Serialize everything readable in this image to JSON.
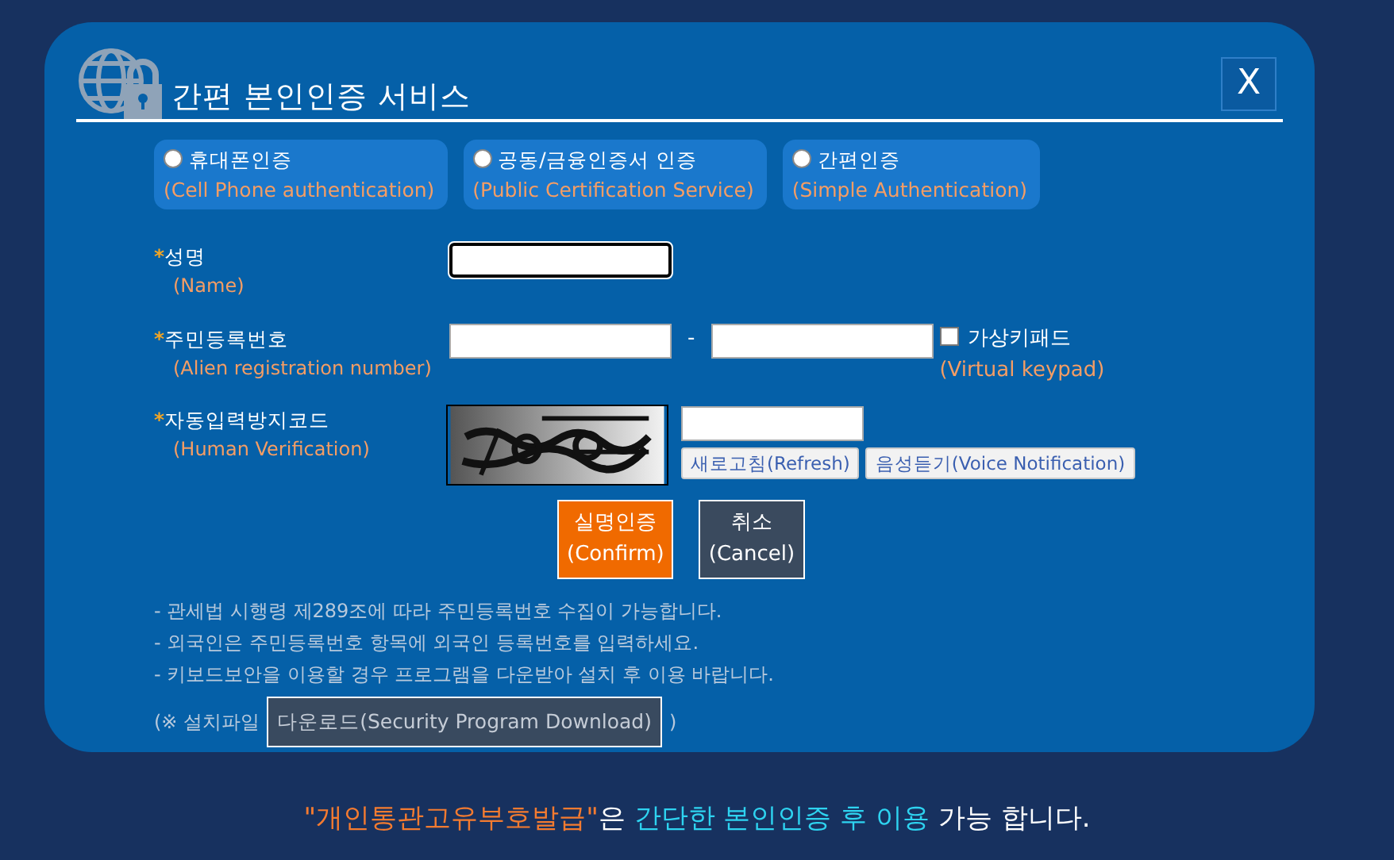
{
  "dialog": {
    "title": "간편 본인인증 서비스",
    "close": "X"
  },
  "auth_methods": [
    {
      "label": "휴대폰인증",
      "english": "(Cell Phone authentication)",
      "selected": false
    },
    {
      "label": "공동/금융인증서 인증",
      "english": "(Public Certification Service)",
      "selected": false
    },
    {
      "label": "간편인증",
      "english": "(Simple Authentication)",
      "selected": false
    }
  ],
  "fields": [
    {
      "kind": "name",
      "mark": "*",
      "label": "성명",
      "english": "(Name)",
      "focused": true
    },
    {
      "kind": "registration",
      "mark": "*",
      "label": "주민등록번호",
      "english": "(Alien registration number)",
      "separator": "-",
      "keypad": {
        "label": "가상키패드",
        "english": "(Virtual keypad)",
        "checked": false
      }
    },
    {
      "kind": "captcha",
      "mark": "*",
      "label": "자동입력방지코드",
      "english": "(Human Verification)",
      "image": {
        "kind": "picture"
      },
      "buttons": [
        "새로고침(Refresh)",
        "음성듣기(Voice Notification)"
      ]
    }
  ],
  "actions": [
    {
      "kind": "confirm",
      "label": "실명인증",
      "english": "(Confirm)"
    },
    {
      "kind": "cancel",
      "label": "취소",
      "english": "(Cancel)"
    }
  ],
  "notes": [
    "- 관세법 시행령 제289조에 따라 주민등록번호 수집이 가능합니다.",
    "- 외국인은 주민등록번호 항목에 외국인 등록번호를 입력하세요.",
    "- 키보드보안을 이용할 경우 프로그램을 다운받아 설치 후 이용 바랍니다."
  ],
  "download": {
    "prefix": "(※ 설치파일",
    "button": "다운로드(Security Program Download)",
    "suffix": ")"
  },
  "footer": [
    {
      "text": "\"개인통관고유부호발급\"",
      "color": "#f47b30"
    },
    {
      "text": "은",
      "color": "#ffffff"
    },
    {
      "text": "간단한 본인인증 후 이용",
      "color": "#2ed3f0"
    },
    {
      "text": "가능 합니다.",
      "color": "#ffffff"
    }
  ]
}
